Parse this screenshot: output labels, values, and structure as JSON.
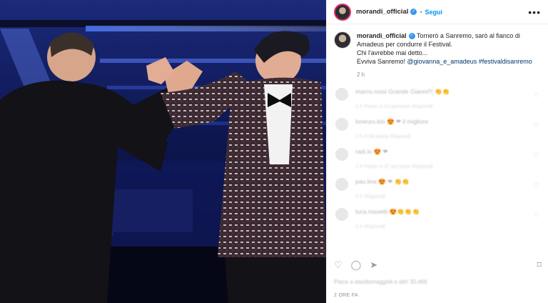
{
  "post": {
    "username": "morandi_official",
    "follow_label": "Segui",
    "more_label": "•••",
    "caption_user": "morandi_official",
    "caption_line1": "Tornerò a Sanremo, sarò al fianco di Amadeus per condurre il Festival.",
    "caption_line2": "Chi l'avrebbe mai detto...",
    "caption_line3_prefix": "Evviva Sanremo! ",
    "caption_mention": "@giovanna_e_amadeus",
    "caption_hashtag": "#festivaldisanremo",
    "time_ago": "2 h",
    "bottom_time": "2 ORE FA"
  },
  "comments": [
    {
      "text": "marco.rossi Grande Gianni!!! 👏👏",
      "meta": "2 h   Piace a 14 persone   Rispondi"
    },
    {
      "text": "lorenzo.bio 😍 ❤ il migliore",
      "meta": "2 h   3 Mi piace   Rispondi"
    },
    {
      "text": "radi.io 😍 ❤",
      "meta": "2 h   Piace a 37 persone   Rispondi"
    },
    {
      "text": "pao.lina 😍 ❤ 👏👏",
      "meta": "2 h   Rispondi"
    },
    {
      "text": "luca.rossetti 😍👏👏👏",
      "meta": "2 h   Rispondi"
    }
  ],
  "likes_text": "Piace a davidomaggioli e altri 30.466",
  "colors": {
    "accent": "#0095f6",
    "verified": "#3897f0",
    "link": "#00376b"
  }
}
